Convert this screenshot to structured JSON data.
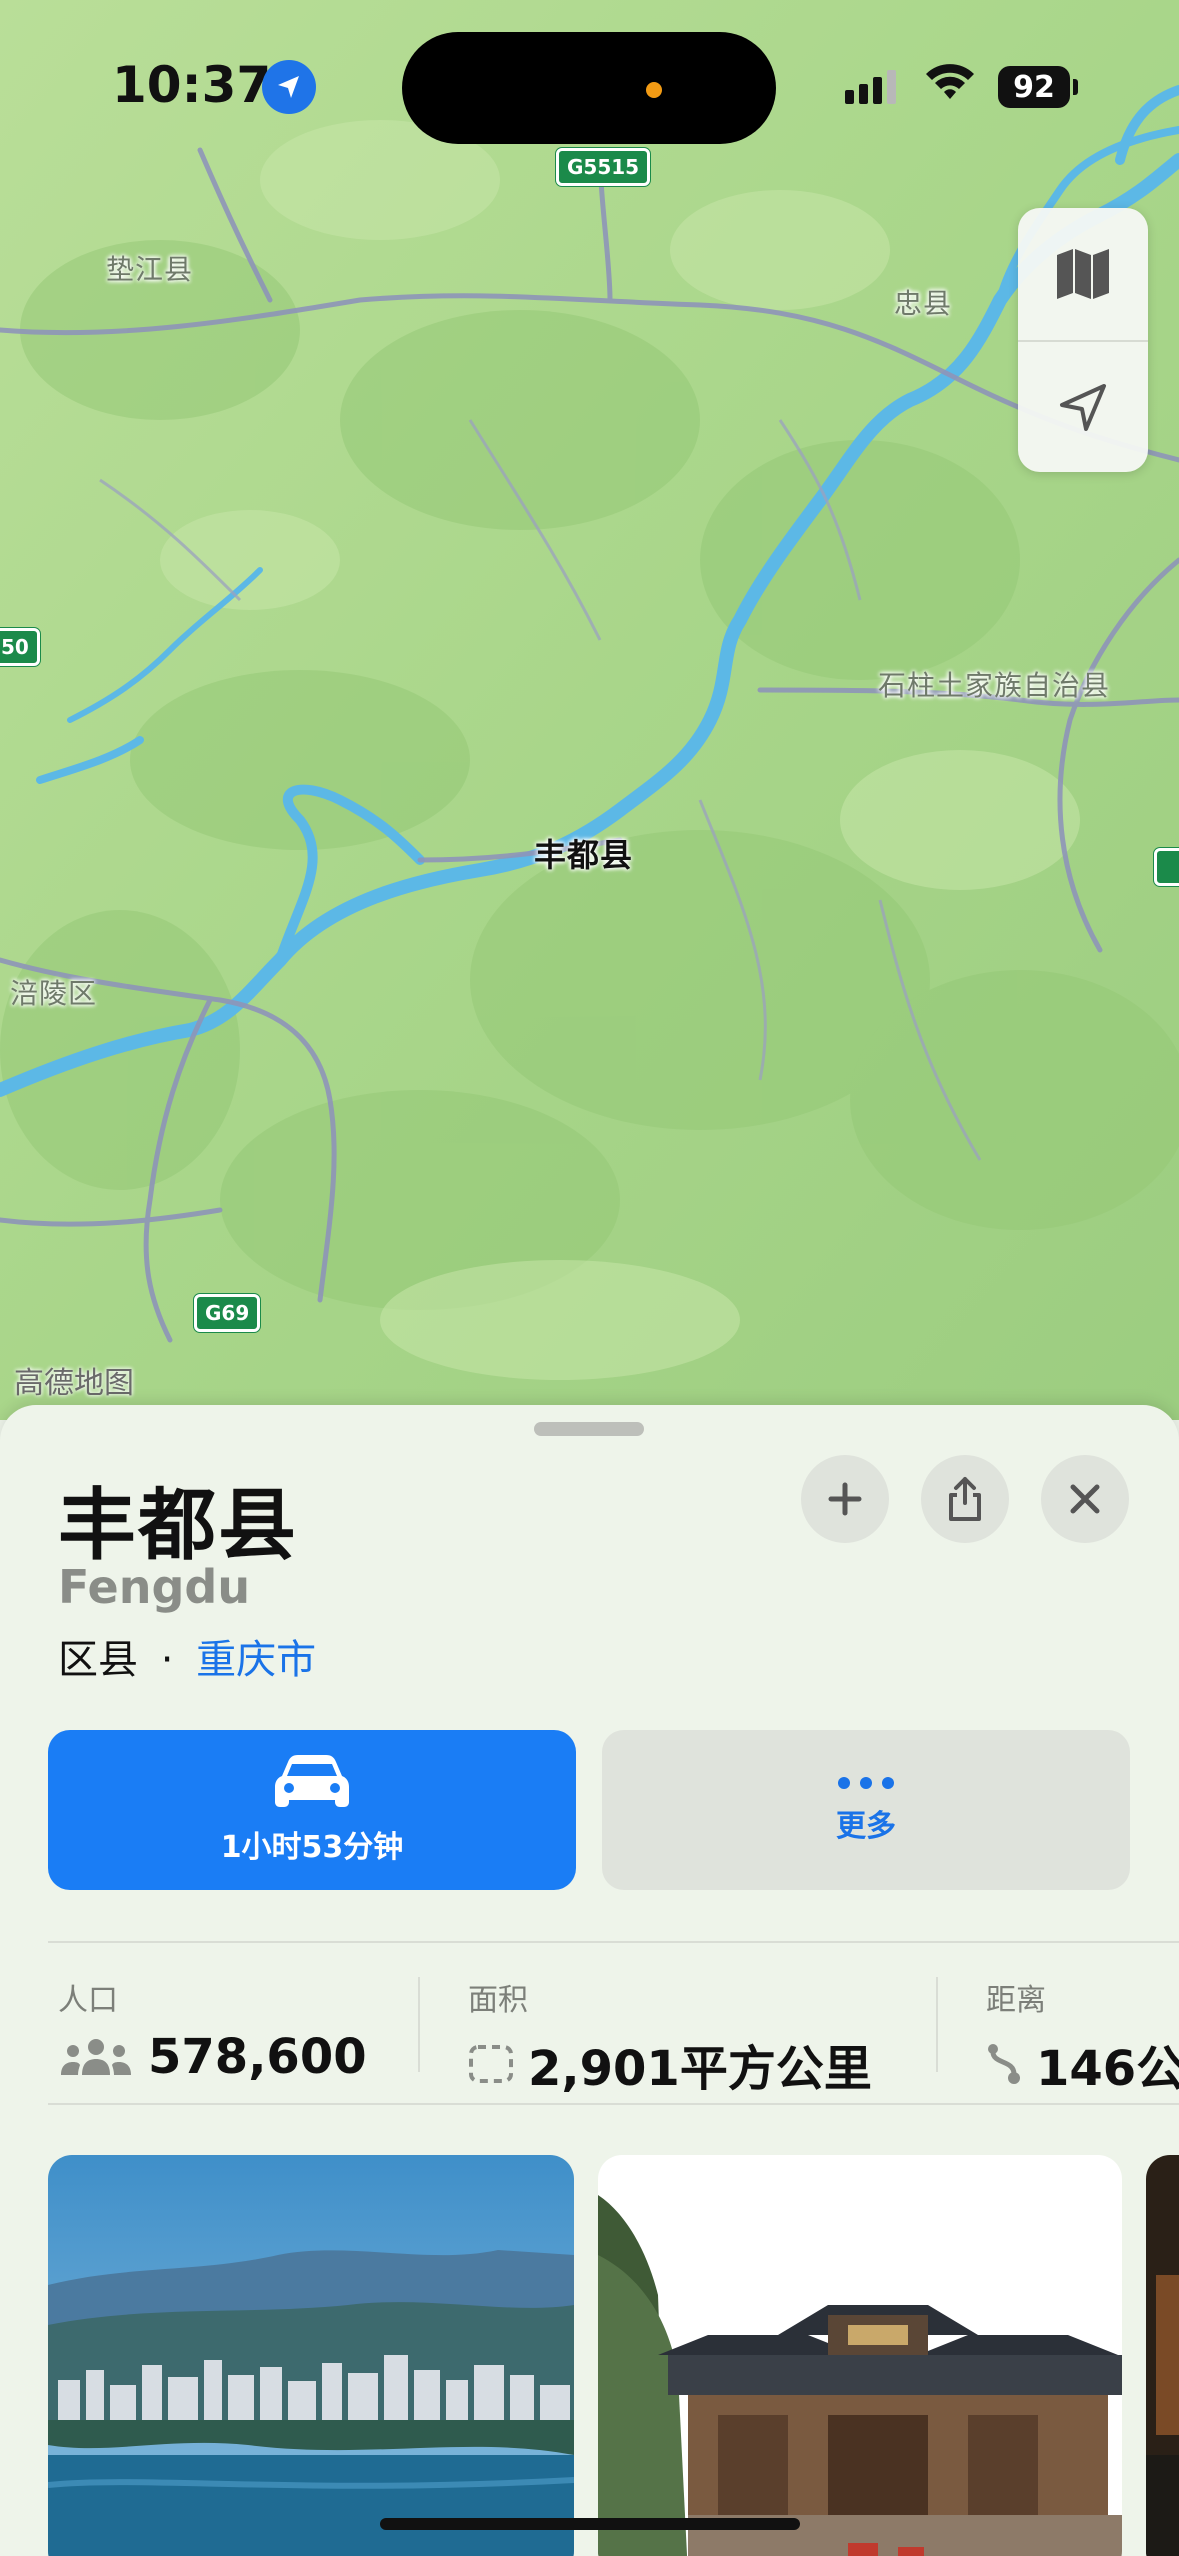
{
  "status_bar": {
    "time": "10:37",
    "battery": "92"
  },
  "map": {
    "labels": {
      "dianjiang": "垫江县",
      "zhongxian": "忠县",
      "shizhu": "石柱土家族自治县",
      "fengdu": "丰都县",
      "fuling": "涪陵区"
    },
    "shields": {
      "g5515": "G5515",
      "g69": "G69",
      "left_edge": "50"
    },
    "attribution": "高德地图"
  },
  "place": {
    "name": "丰都县",
    "name_latin": "Fengdu",
    "category": "区县",
    "separator": "·",
    "parent": "重庆市"
  },
  "actions": {
    "drive_time": "1小时53分钟",
    "more": "更多"
  },
  "stats": {
    "population_label": "人口",
    "population_value": "578,600",
    "area_label": "面积",
    "area_value": "2,901平方公里",
    "distance_label": "距离",
    "distance_value": "146公"
  },
  "colors": {
    "accent": "#1a7df5",
    "link": "#1a73e8",
    "map_land": "#a6d584",
    "map_water": "#5cb8e6",
    "road": "#8e95b8",
    "highway_shield": "#1b8a4a"
  }
}
